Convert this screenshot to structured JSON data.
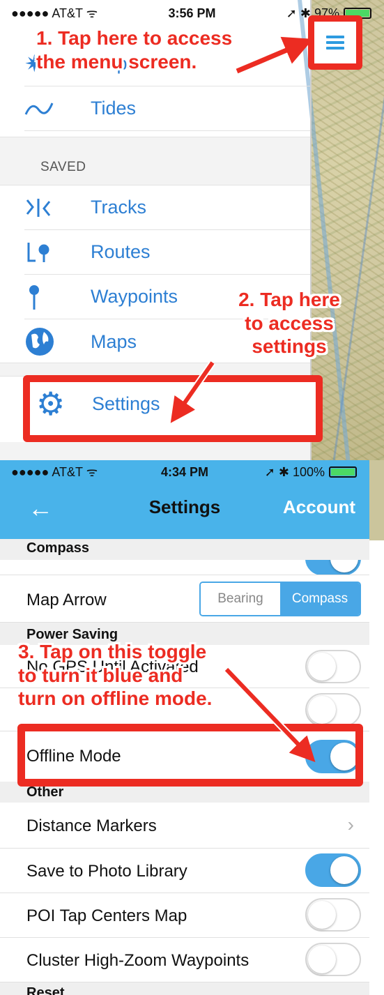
{
  "top": {
    "status_bar": {
      "carrier": "●●●●● AT&T ᯤ",
      "time": "3:56 PM",
      "right": "➚ ✱ 97%",
      "battery_level": 0.97
    },
    "menu": {
      "partial_item_label": "Maps",
      "tides_label": "Tides",
      "saved_heading": "SAVED",
      "tracks_label": "Tracks",
      "routes_label": "Routes",
      "waypoints_label": "Waypoints",
      "maps_label": "Maps",
      "settings_label": "Settings"
    },
    "annotation_1": {
      "line1": "1. Tap here to access",
      "line2": "the menu screen."
    },
    "annotation_2": {
      "line1": "2. Tap here",
      "line2": "to access",
      "line3": "settings"
    }
  },
  "bottom": {
    "status_bar": {
      "carrier": "●●●●● AT&T ᯤ",
      "time": "4:34 PM",
      "right": "➚ ✱ 100%",
      "battery_level": 1.0
    },
    "header": {
      "back": "←",
      "title": "Settings",
      "account": "Account"
    },
    "compass_heading": "Compass",
    "map_arrow_label": "Map Arrow",
    "map_arrow_options": [
      "Bearing",
      "Compass"
    ],
    "map_arrow_selected": "Compass",
    "power_saving_heading": "Power Saving",
    "no_gps_label": "No GPS Until Activated",
    "offline_mode_label": "Offline Mode",
    "other_heading": "Other",
    "distance_markers_label": "Distance Markers",
    "save_photo_label": "Save to Photo Library",
    "poi_tap_label": "POI Tap Centers Map",
    "cluster_label": "Cluster High-Zoom Waypoints",
    "reset_heading": "Reset",
    "annotation_3": {
      "line1": "3. Tap on this toggle",
      "line2": "to turn it blue and",
      "line3": "turn on offline mode."
    },
    "toggles": {
      "compass_top": true,
      "no_gps": false,
      "second_power": false,
      "offline_mode": true,
      "save_photo": true,
      "poi_tap": false,
      "cluster": false
    }
  },
  "colors": {
    "accent": "#49b3ea",
    "annotation_red": "#ec2c22",
    "menu_blue": "#2d7fd3"
  }
}
